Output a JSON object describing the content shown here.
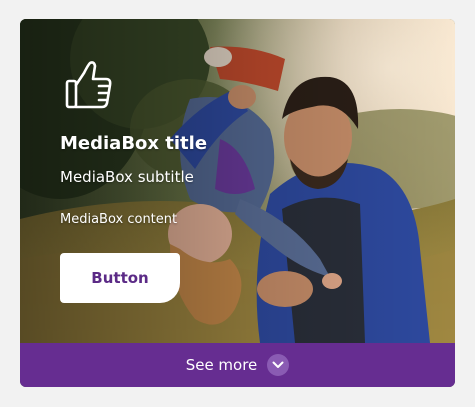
{
  "mediabox": {
    "title": "MediaBox title",
    "subtitle": "MediaBox subtitle",
    "content": "MediaBox content",
    "button_label": "Button",
    "icon": "thumbs-up-icon",
    "image": "family-playing-outdoors-photo"
  },
  "footer": {
    "label": "See more",
    "icon": "chevron-down-icon"
  },
  "colors": {
    "brand_purple": "#662d91",
    "button_text": "#5b2a86",
    "button_bg": "#ffffff",
    "page_bg": "#f2f2f2"
  }
}
